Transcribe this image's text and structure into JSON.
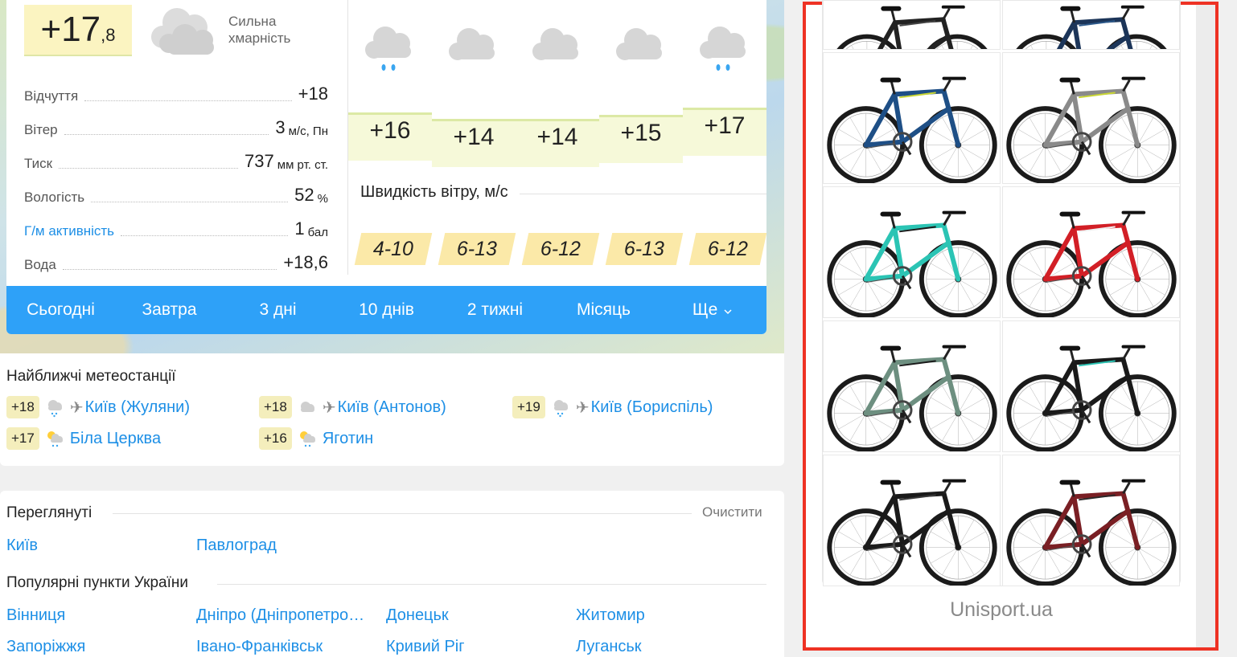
{
  "current": {
    "temp_main": "+17",
    "temp_decimal": ",8",
    "condition": "Сильна хмарність"
  },
  "params": [
    {
      "label": "Відчуття",
      "value": "+18",
      "unit": "",
      "link": false
    },
    {
      "label": "Вітер",
      "value": "3",
      "unit": "м/с, Пн",
      "link": false
    },
    {
      "label": "Тиск",
      "value": "737",
      "unit": "мм рт. ст.",
      "link": false
    },
    {
      "label": "Вологість",
      "value": "52",
      "unit": "%",
      "link": false
    },
    {
      "label": "Г/м активність",
      "value": "1",
      "unit": "бал",
      "link": true
    },
    {
      "label": "Вода",
      "value": "+18,6",
      "unit": "",
      "link": false
    }
  ],
  "forecast": {
    "icons": [
      "cloud-rain-icon",
      "cloud-icon",
      "cloud-icon",
      "cloud-icon",
      "cloud-rain-icon"
    ],
    "temps": [
      "+16",
      "+14",
      "+14",
      "+15",
      "+17"
    ],
    "wind_title": "Швидкість вітру, м/с",
    "wind": [
      "4-10",
      "6-13",
      "6-12",
      "6-13",
      "6-12"
    ]
  },
  "tabs": [
    "Сьогодні",
    "Завтра",
    "3 дні",
    "10 днів",
    "2 тижні",
    "Місяць",
    "Ще"
  ],
  "stations": {
    "title": "Найближчі метеостанції",
    "items": [
      {
        "temp": "+18",
        "icon": "cloud-rain-icon",
        "airport": true,
        "name": "Київ (Жуляни)"
      },
      {
        "temp": "+18",
        "icon": "cloud-icon",
        "airport": true,
        "name": "Київ (Антонов)"
      },
      {
        "temp": "+19",
        "icon": "cloud-rain-icon",
        "airport": true,
        "name": "Київ (Бориспіль)"
      },
      {
        "temp": "+17",
        "icon": "sun-cloud-rain-icon",
        "airport": false,
        "name": "Біла Церква"
      },
      {
        "temp": "+16",
        "icon": "sun-cloud-rain-icon",
        "airport": false,
        "name": "Яготин"
      }
    ]
  },
  "viewed": {
    "title": "Переглянуті",
    "clear": "Очистити",
    "cities": [
      "Київ",
      "Павлоград"
    ]
  },
  "popular": {
    "title": "Популярні пункти України",
    "cities": [
      "Вінниця",
      "Дніпро (Дніпропетро…",
      "Донецьк",
      "Житомир",
      "Запоріжжя",
      "Івано-Франківськ",
      "Кривий Ріг",
      "Луганськ"
    ]
  },
  "ad": {
    "brand": "Unisport.ua",
    "bikes": [
      {
        "name": "bike-black-partial",
        "frame": "#222222",
        "accent": "#444444"
      },
      {
        "name": "bike-navy-partial",
        "frame": "#1c3559",
        "accent": "#2d5a8c"
      },
      {
        "name": "bike-blue-mtb",
        "frame": "#1e4f86",
        "accent": "#c9d633"
      },
      {
        "name": "bike-grey-mtb",
        "frame": "#8a8a8a",
        "accent": "#c9d633"
      },
      {
        "name": "bike-celeste-road",
        "frame": "#2bc4b4",
        "accent": "#1a1a1a"
      },
      {
        "name": "bike-red-white-tt",
        "frame": "#d21f26",
        "accent": "#f0f0f0"
      },
      {
        "name": "bike-sage-mtb",
        "frame": "#6d8f80",
        "accent": "#1a1a1a"
      },
      {
        "name": "bike-black-celeste-road",
        "frame": "#1a1a1a",
        "accent": "#2bc4b4"
      },
      {
        "name": "bike-black-gravel",
        "frame": "#1a1a1a",
        "accent": "#3a3a3a"
      },
      {
        "name": "bike-darkred-ebike",
        "frame": "#7a1f24",
        "accent": "#2a2a2a"
      }
    ]
  }
}
